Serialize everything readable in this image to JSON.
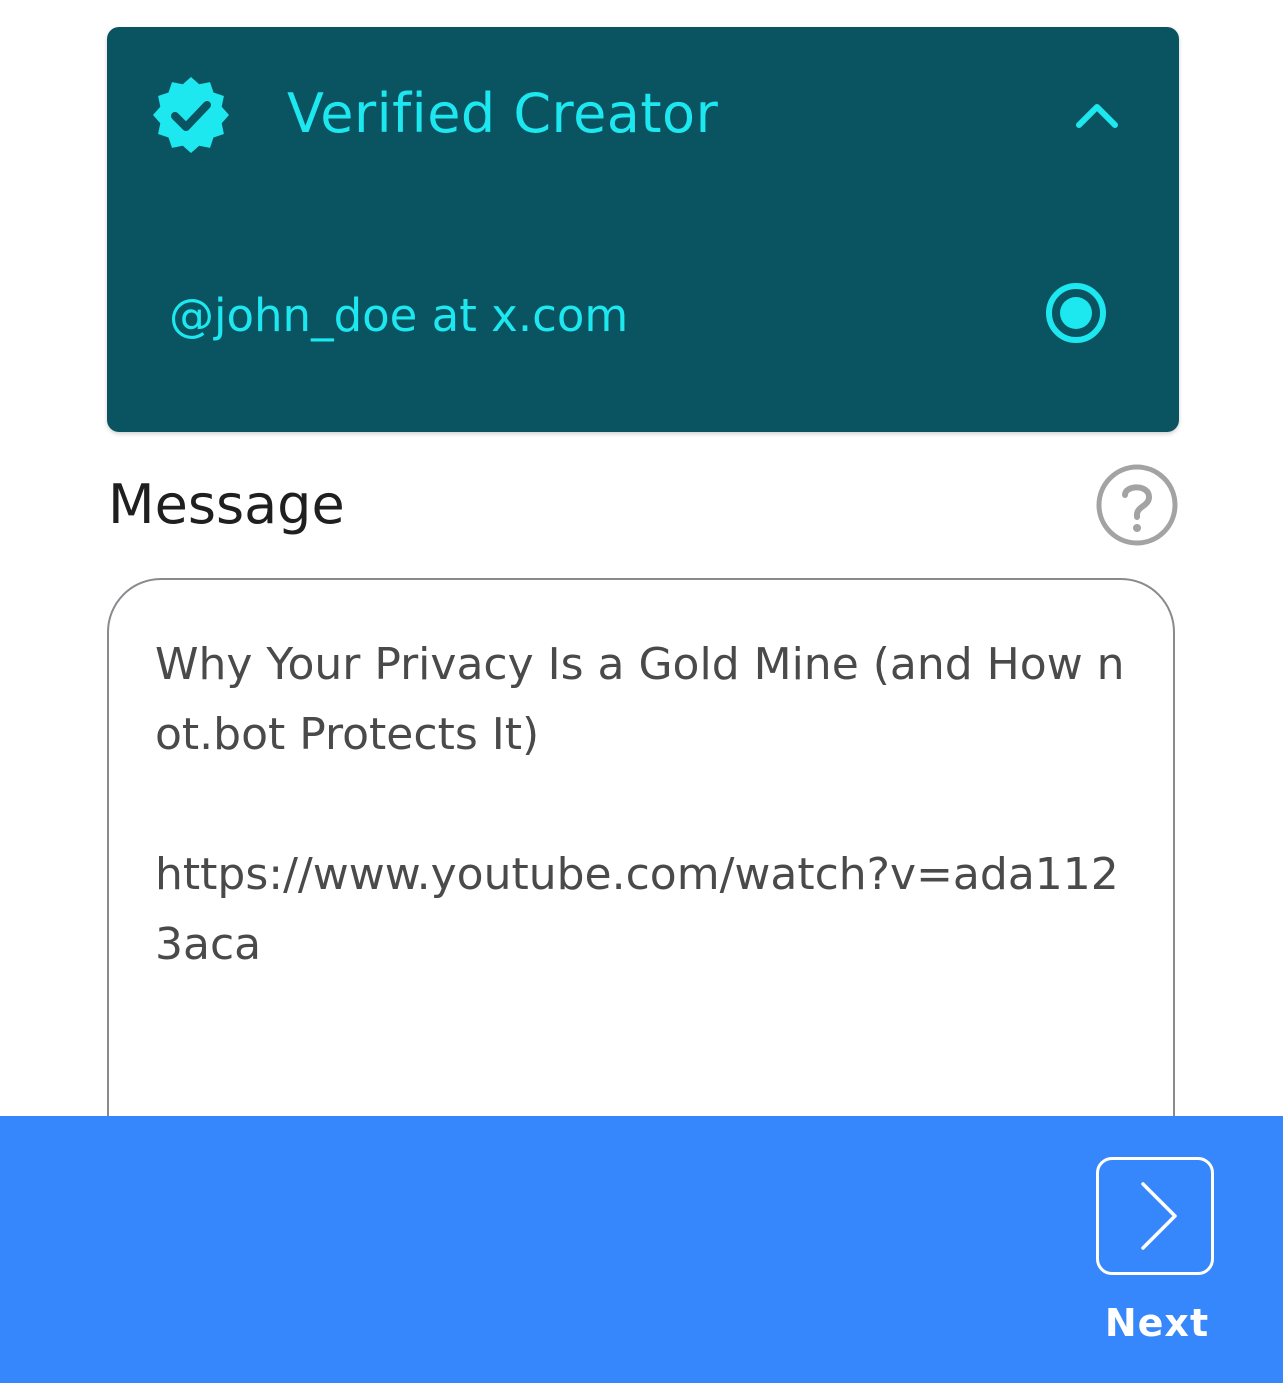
{
  "creator_card": {
    "title": "Verified Creator",
    "badge_icon": "verified-badge-icon",
    "toggle_icon": "chevron-up-icon",
    "expanded": true,
    "account": {
      "label": "@john_doe at x.com",
      "selected": true
    }
  },
  "message": {
    "label": "Message",
    "help_icon": "question-circle-icon",
    "value": "Why Your Privacy Is a Gold Mine (and How not.bot Protects It)\n\nhttps://www.youtube.com/watch?v=ada1123aca"
  },
  "footer": {
    "next_label": "Next",
    "next_icon": "chevron-right-icon"
  },
  "colors": {
    "card_background": "#0a5462",
    "card_accent": "#1de7ef",
    "bottom_bar": "#3687fb",
    "text_dark": "#1f1f1f",
    "text_message": "#4a4a4a",
    "border_gray": "#8a8a8e"
  }
}
